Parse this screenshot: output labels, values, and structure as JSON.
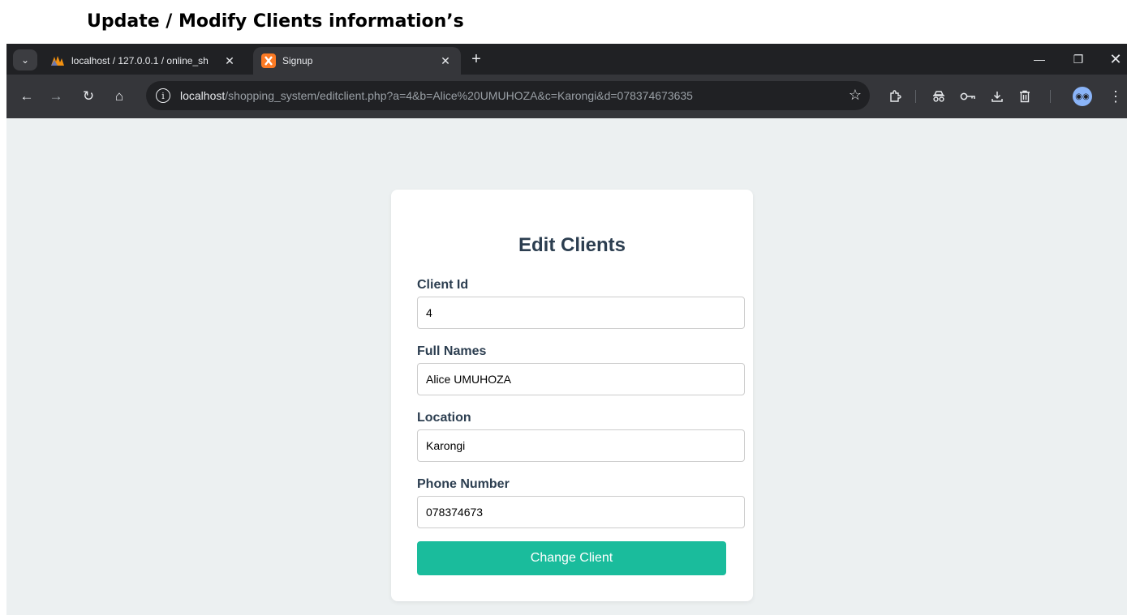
{
  "doc_heading": "Update / Modify Clients information’s",
  "browser": {
    "tabs": [
      {
        "title": "localhost / 127.0.0.1 / online_sh",
        "favicon": "phpmyadmin-icon",
        "active": false
      },
      {
        "title": "Signup",
        "favicon": "xampp-icon",
        "active": true
      }
    ],
    "url_host": "localhost",
    "url_path": "/shopping_system/editclient.php?a=4&b=Alice%20UMUHOZA&c=Karongi&d=078374673635",
    "icons": {
      "tab_search": "chevron-down-icon",
      "close": "close-icon",
      "new_tab": "plus-icon",
      "minimize": "minimize-icon",
      "restore": "restore-icon",
      "window_close": "close-icon",
      "back": "back-arrow-icon",
      "forward": "forward-arrow-icon",
      "reload": "reload-icon",
      "home": "home-icon",
      "site_info": "info-icon",
      "bookmark": "star-icon",
      "extensions": "puzzle-icon",
      "incognito": "incognito-icon",
      "passwords": "key-icon",
      "downloads": "download-icon",
      "delete": "trash-icon",
      "profile": "avatar-icon",
      "menu": "kebab-menu-icon"
    }
  },
  "form": {
    "title": "Edit Clients",
    "fields": [
      {
        "label": "Client Id",
        "value": "4"
      },
      {
        "label": "Full Names",
        "value": "Alice UMUHOZA"
      },
      {
        "label": "Location",
        "value": "Karongi"
      },
      {
        "label": "Phone Number",
        "value": "078374673"
      }
    ],
    "submit_label": "Change Client"
  },
  "colors": {
    "page_bg": "#ecf0f1",
    "accent": "#1abc9c",
    "heading": "#2c3e50",
    "chrome_dark": "#202124",
    "chrome_toolbar": "#35363a"
  }
}
